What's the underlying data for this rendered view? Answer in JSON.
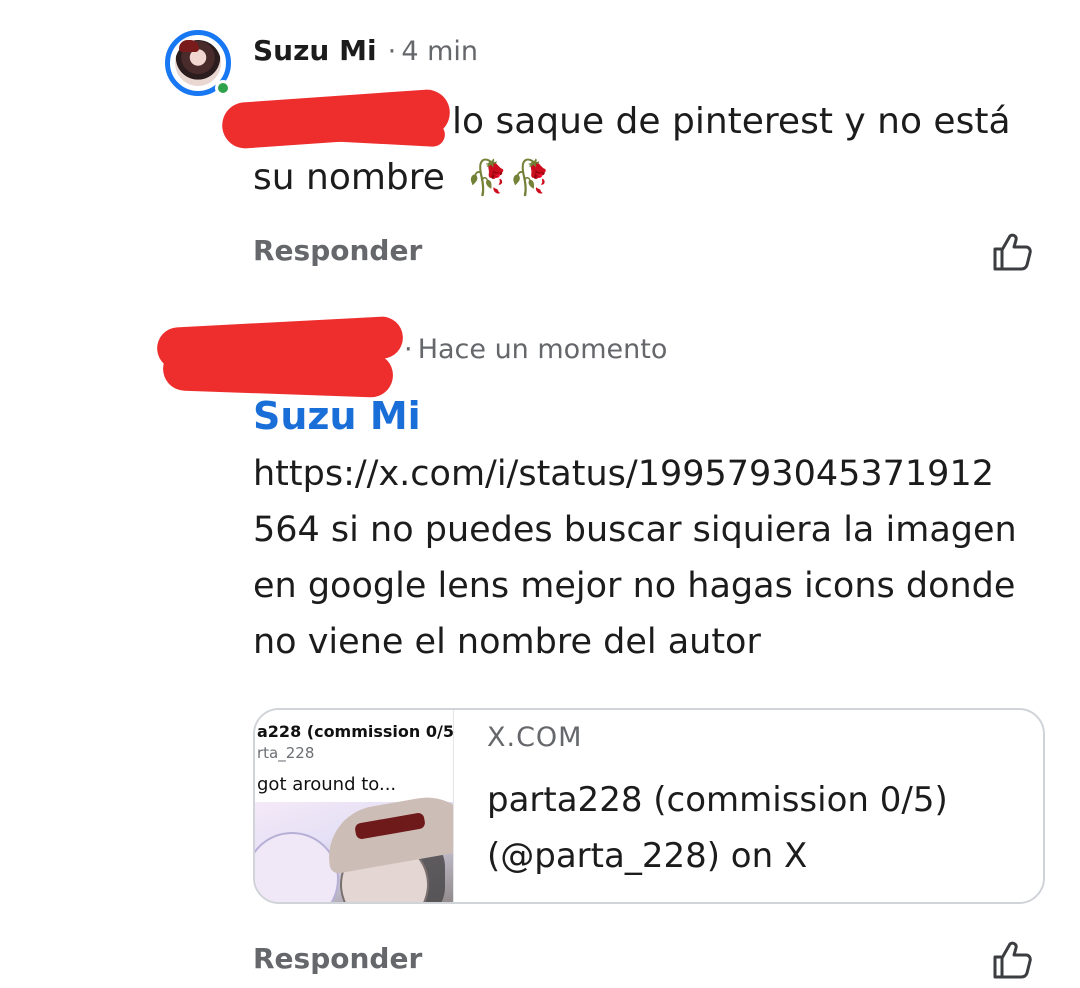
{
  "comment1": {
    "author": "Suzu Mi",
    "separator": "·",
    "time": "4 min",
    "text_line1": "lo saque de pinterest y no está",
    "text_line2": "su nombre",
    "emoji": "🥀🥀",
    "reply_label": "Responder"
  },
  "comment2": {
    "separator": "·",
    "time": "Hace un momento",
    "mention": "Suzu Mi",
    "text_lines": [
      "https://x.com/i/status/1995793045371912",
      "564 si no puedes buscar siquiera la imagen",
      "en google lens mejor no hagas icons donde",
      "no viene el nombre del autor"
    ],
    "reply_label": "Responder"
  },
  "link_preview": {
    "domain": "X.COM",
    "title": "parta228 (commission 0/5) (@parta_228) on X",
    "thumb_title": "a228 (commission 0/5)",
    "thumb_handle": "rta_228",
    "thumb_text": "got around to..."
  },
  "colors": {
    "accent": "#1877f2",
    "mention": "#1a6ed8",
    "redaction": "#ee2d2d",
    "muted": "#65676b",
    "online": "#31a24c"
  },
  "icons": [
    "avatar",
    "thumbs-up-icon",
    "wilted-rose-emoji"
  ]
}
